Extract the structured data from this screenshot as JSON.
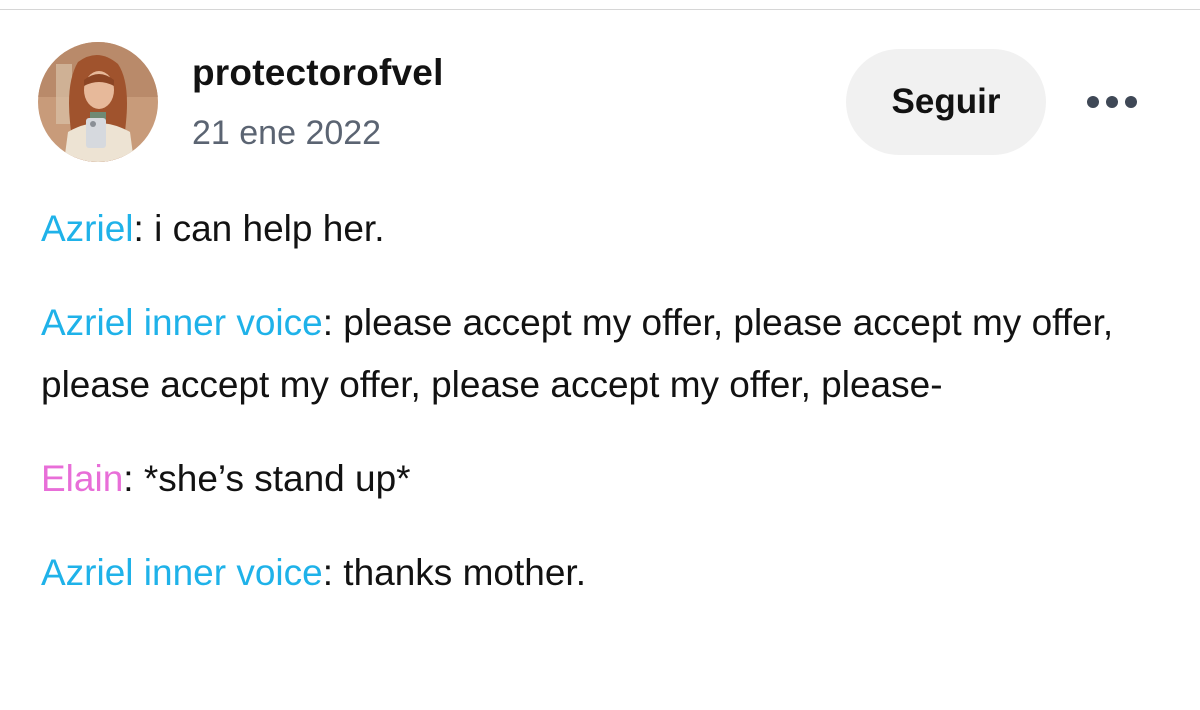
{
  "post": {
    "author": {
      "username": "protectorofvel",
      "date": "21 ene 2022",
      "avatar_icon": "avatar-photo"
    },
    "follow_label": "Seguir",
    "more_icon": "more-dots-icon",
    "lines": [
      {
        "speaker": "Azriel",
        "speaker_color": "#1fb2e9",
        "separator": ": ",
        "text": "i can help her."
      },
      {
        "speaker": "Azriel inner voice",
        "speaker_color": "#1fb2e9",
        "separator": ": ",
        "text": "please accept my offer, please accept my offer, please accept my offer, please accept my offer, please-"
      },
      {
        "speaker": "Elain",
        "speaker_color": "#e86ed8",
        "separator": ": ",
        "text": "*she’s stand up*"
      },
      {
        "speaker": "Azriel inner voice",
        "speaker_color": "#1fb2e9",
        "separator": ": ",
        "text": "thanks mother."
      }
    ]
  },
  "colors": {
    "speaker_blue": "#1fb2e9",
    "speaker_pink": "#e86ed8",
    "button_bg": "#f1f1f1",
    "date_text": "#5b6472"
  }
}
